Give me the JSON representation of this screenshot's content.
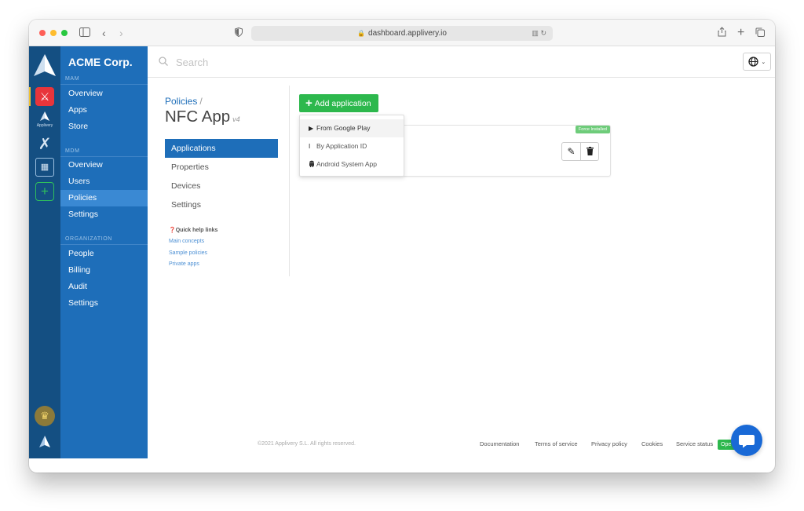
{
  "browser": {
    "url": "dashboard.applivery.io"
  },
  "rail": {
    "app_label": "Applivery"
  },
  "nav": {
    "org_name": "ACME Corp.",
    "sections": [
      {
        "label": "MAM",
        "items": [
          "Overview",
          "Apps",
          "Store"
        ]
      },
      {
        "label": "MDM",
        "items": [
          "Overview",
          "Users",
          "Policies",
          "Settings"
        ]
      },
      {
        "label": "ORGANIZATION",
        "items": [
          "People",
          "Billing",
          "Audit",
          "Settings"
        ]
      }
    ],
    "active_item": "Policies"
  },
  "search": {
    "placeholder": "Search"
  },
  "page": {
    "breadcrumb": "Policies",
    "breadcrumb_sep": "/",
    "title": "NFC App",
    "version": "v4"
  },
  "subnav": {
    "items": [
      "Applications",
      "Properties",
      "Devices",
      "Settings"
    ],
    "active": "Applications"
  },
  "help": {
    "title": "Quick help links",
    "links": [
      "Main concepts",
      "Sample policies",
      "Private apps"
    ]
  },
  "actions": {
    "add_application": "Add application"
  },
  "dropdown": {
    "items": [
      {
        "label": "From Google Play",
        "icon": "play-icon"
      },
      {
        "label": "By Application ID",
        "icon": "text-cursor-icon"
      },
      {
        "label": "Android System App",
        "icon": "android-icon"
      }
    ]
  },
  "app_card": {
    "badge": "Force Installed"
  },
  "footer": {
    "copyright": "©2021 Applivery S.L. All rights reserved.",
    "links": [
      "Documentation",
      "Terms of service",
      "Privacy policy",
      "Cookies",
      "Service status"
    ],
    "status_badge": "Ope"
  },
  "colors": {
    "rail_bg": "#144f82",
    "sidebar_bg": "#1e6eb9",
    "sidebar_active": "#3a89d3",
    "primary": "#1e6eb9",
    "success": "#2db84d",
    "chat": "#1969d6"
  }
}
